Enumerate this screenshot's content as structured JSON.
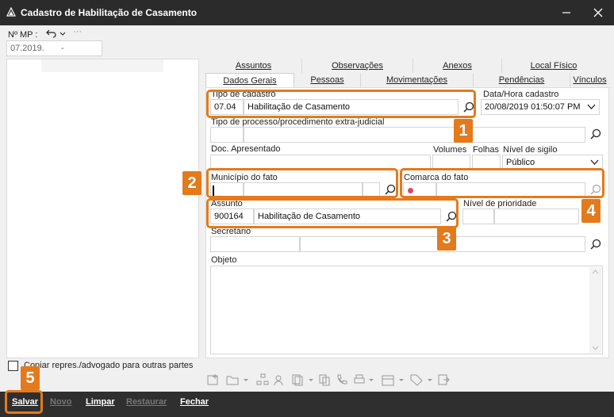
{
  "window": {
    "title": "Cadastro de Habilitação de Casamento",
    "minimize_glyph": "🔺",
    "close_glyph": "✕"
  },
  "mp": {
    "label": "Nº MP :",
    "number_part1": "07.2019.",
    "number_part2": "-"
  },
  "tabs_row1": [
    "Assuntos",
    "Observações",
    "Anexos",
    "Local Físico"
  ],
  "tabs_row2": [
    "Dados Gerais",
    "Pessoas",
    "Movimentações",
    "Pendências",
    "Vínculos"
  ],
  "form": {
    "tipo_cadastro": {
      "label": "Tipo de cadastro",
      "code": "07.04",
      "value": "Habilitação de Casamento"
    },
    "data_hora": {
      "label": "Data/Hora cadastro",
      "value": "20/08/2019 01:50:07 PM"
    },
    "tipo_processo": {
      "label": "Tipo de processo/procedimento extra-judicial",
      "value": ""
    },
    "doc_apresentado": {
      "label": "Doc. Apresentado",
      "value": ""
    },
    "volumes": {
      "label": "Volumes",
      "value": ""
    },
    "folhas": {
      "label": "Folhas",
      "value": ""
    },
    "nivel_sigilo": {
      "label": "Nível de sigilo",
      "value": "Público"
    },
    "municipio": {
      "label": "Município do fato",
      "value": ""
    },
    "comarca": {
      "label": "Comarca do fato",
      "value": ""
    },
    "assunto": {
      "label": "Assunto",
      "code": "900164",
      "value": "Habilitação de Casamento"
    },
    "nivel_prioridade": {
      "label": "Nível de prioridade",
      "value": ""
    },
    "secretario": {
      "label": "Secretário",
      "value": ""
    },
    "objeto": {
      "label": "Objeto",
      "value": ""
    }
  },
  "copy_checkbox": {
    "label": "Copiar repres./advogado para outras partes",
    "checked": false
  },
  "badges": [
    "1",
    "2",
    "3",
    "4",
    "5"
  ],
  "bottom_buttons": [
    {
      "label": "Salvar",
      "enabled": true
    },
    {
      "label": "Novo",
      "enabled": false
    },
    {
      "label": "Limpar",
      "enabled": true
    },
    {
      "label": "Restaurar",
      "enabled": false
    },
    {
      "label": "Fechar",
      "enabled": true
    }
  ],
  "colors": {
    "highlight": "#e37a1c",
    "titlebar": "#2b2b2b",
    "bottombar": "#2f2f2f",
    "required_dot": "#e0475b"
  }
}
